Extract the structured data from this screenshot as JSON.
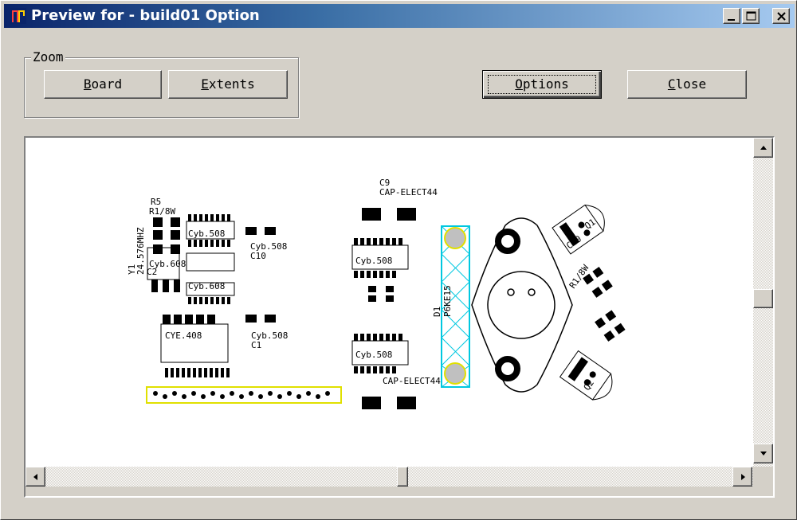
{
  "window": {
    "title": "Preview for - build01 Option",
    "minimize_icon": "minimize-icon",
    "maximize_icon": "maximize-icon",
    "close_icon": "close-icon"
  },
  "zoom": {
    "group_label": "Zoom",
    "board_button": {
      "mnemonic": "B",
      "rest": "oard"
    },
    "extents_button": {
      "mnemonic": "E",
      "rest": "xtents"
    }
  },
  "actions": {
    "options_button": {
      "mnemonic": "O",
      "rest": "ptions"
    },
    "close_button": {
      "mnemonic": "C",
      "rest": "lose"
    }
  },
  "preview": {
    "silk_labels": {
      "r5": "R5",
      "r5_value": "R1/8W",
      "crystal": "Y1",
      "crystal_value": "24.576MHZ",
      "cap_a": "Cyb.508",
      "cap_b": "Cyb.608",
      "cap_c": "Cyb.608",
      "c10": "Cyb.508",
      "c10_ref": "C10",
      "c2": "C2",
      "ic": "CYE.408",
      "c1_val": "Cyb.508",
      "c1_ref": "C1",
      "c9_ref": "C9",
      "c9_val": "CAP-ELECT44",
      "mid_top": "Cyb.508",
      "mid_bot": "Cyb.508",
      "elect_bottom": "CAP-ELECT44",
      "d1": "D1",
      "d1_val": "P6KE15",
      "q1": "Q1",
      "q1_val": "C10",
      "r_right": "R1/8W",
      "q2": "Q2"
    }
  },
  "scrollbars": {
    "up_arrow_icon": "arrow-up-icon",
    "down_arrow_icon": "arrow-down-icon",
    "left_arrow_icon": "arrow-left-icon",
    "right_arrow_icon": "arrow-right-icon"
  }
}
